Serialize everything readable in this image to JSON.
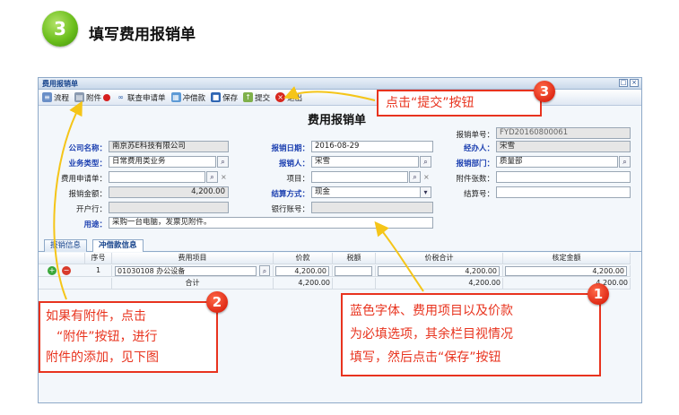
{
  "step": {
    "number": "3",
    "title": "填写费用报销单"
  },
  "window": {
    "title": "费用报销单",
    "buttons": [
      "□",
      "×"
    ]
  },
  "toolbar": {
    "process": "流程",
    "attachment": "附件",
    "linked_request": "联查申请单",
    "offset": "冲借款",
    "save": "保存",
    "submit": "提交",
    "exit": "退出"
  },
  "form": {
    "title": "费用报销单",
    "doc_no_label": "报销单号：",
    "doc_no": "FYD20160800061",
    "company_label": "公司名称：",
    "company": "南京苏E科技有限公司",
    "date_label": "报销日期：",
    "date": "2016-08-29",
    "handler_label": "经办人：",
    "handler": "宋雪",
    "biz_type_label": "业务类型：",
    "biz_type": "日常费用类业务",
    "claimant_label": "报销人：",
    "claimant": "宋雪",
    "dept_label": "报销部门：",
    "dept": "质量部",
    "request_label": "费用申请单：",
    "project_label": "项目：",
    "attach_count_label": "附件张数：",
    "amount_label": "报销金额：",
    "amount": "4,200.00",
    "settle_label": "结算方式：",
    "settle": "现金",
    "settle_no_label": "结算号：",
    "bank_label": "开户行：",
    "account_label": "银行账号：",
    "purpose_label": "用途：",
    "purpose": "采购一台电脑，发票见附件。"
  },
  "tabs": [
    "报销信息",
    "冲借款信息"
  ],
  "grid": {
    "headers": [
      "序号",
      "费用项目",
      "价款",
      "税额",
      "价税合计",
      "核定金额"
    ],
    "rows": [
      {
        "no": "1",
        "item": "01030108 办公设备",
        "price": "4,200.00",
        "tax": "",
        "total": "4,200.00",
        "approved": "4,200.00"
      }
    ],
    "sum_label": "合计",
    "sum_price": "4,200.00",
    "sum_total": "4,200.00",
    "sum_approved": "4,200.00"
  },
  "callouts": {
    "c1": {
      "badge": "1",
      "line1": "蓝色字体、费用项目以及价款",
      "line2": "为必填选项，其余栏目视情况",
      "line3": "填写，然后点击“保存”按钮"
    },
    "c2": {
      "badge": "2",
      "line1": "如果有附件，点击",
      "line2": "“附件”按钮，进行",
      "line3": "附件的添加，见下图"
    },
    "c3": {
      "badge": "3",
      "text": "点击“提交”按钮"
    }
  },
  "colors": {
    "required_label": "#1b3fb0",
    "callout": "#e8331e",
    "step_badge": "#6cbf1d",
    "arrow": "#f5c518"
  }
}
